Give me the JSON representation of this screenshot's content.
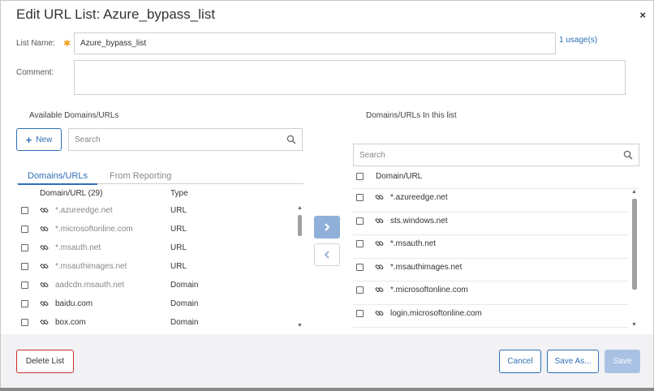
{
  "dialog": {
    "title": "Edit URL List: Azure_bypass_list",
    "close_glyph": "×",
    "list_name_label": "List Name:",
    "required_glyph": "✱",
    "list_name_value": "Azure_bypass_list",
    "usage_link": "1 usage(s)",
    "comment_label": "Comment:",
    "comment_value": ""
  },
  "available": {
    "section_title": "Available Domains/URLs",
    "new_button": "New",
    "new_glyph": "+",
    "search_placeholder": "Search",
    "tabs": [
      "Domains/URLs",
      "From Reporting"
    ],
    "active_tab": "Domains/URLs",
    "columns": {
      "domain": "Domain/URL (29)",
      "type": "Type"
    },
    "rows": [
      {
        "domain": "*.azureedge.net",
        "type": "URL",
        "style": "muted"
      },
      {
        "domain": "*.microsoftonline.com",
        "type": "URL",
        "style": "muted"
      },
      {
        "domain": "*.msauth.net",
        "type": "URL",
        "style": "muted"
      },
      {
        "domain": "*.msauthimages.net",
        "type": "URL",
        "style": "muted"
      },
      {
        "domain": "aadcdn.msauth.net",
        "type": "Domain",
        "style": "muted"
      },
      {
        "domain": "baidu.com",
        "type": "Domain",
        "style": "dark"
      },
      {
        "domain": "box.com",
        "type": "Domain",
        "style": "dark"
      }
    ]
  },
  "move_buttons": {
    "add_glyph": "›",
    "remove_glyph": "‹"
  },
  "selected": {
    "section_title": "Domains/URLs In this list",
    "search_placeholder": "Search",
    "column": "Domain/URL",
    "rows": [
      {
        "domain": "*.azureedge.net"
      },
      {
        "domain": "sts.windows.net"
      },
      {
        "domain": "*.msauth.net"
      },
      {
        "domain": "*.msauthimages.net"
      },
      {
        "domain": "*.microsoftonline.com"
      },
      {
        "domain": "login.microsoftonline.com"
      }
    ]
  },
  "footer": {
    "delete_button": "Delete List",
    "cancel_button": "Cancel",
    "save_as_button": "Save As...",
    "save_button": "Save"
  },
  "colors": {
    "accent": "#2f6fb5",
    "danger": "#c9302c",
    "required": "#f0a020",
    "disabled_primary": "#a9c1e3"
  },
  "icons": {
    "close": "close-icon",
    "required": "required-asterisk-icon",
    "plus": "plus-icon",
    "search": "search-icon",
    "link": "link-icon",
    "chevron_right": "chevron-right-icon",
    "chevron_left": "chevron-left-icon",
    "scroll_up": "scroll-up-arrow-icon",
    "scroll_down": "scroll-down-arrow-icon"
  }
}
